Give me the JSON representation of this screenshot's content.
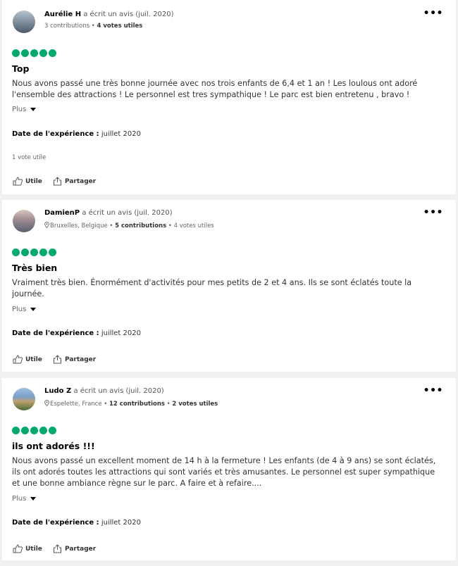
{
  "reviews": [
    {
      "author": "Aurélie H",
      "wrote": "a écrit un avis (juil. 2020)",
      "location": "",
      "contributions": "3 contributions",
      "useful_votes": "4 votes utiles",
      "rating": 5,
      "title": "Top",
      "text": "Nous avons passé une très bonne journée avec nos trois enfants de 6,4 et 1 an ! Les loulous ont adoré l'ensemble des attractions ! Le personnel est tres sympathique ! Le parc est bien entretenu , bravo !",
      "more": "Plus",
      "date_label": "Date de l'expérience :",
      "date_value": "juillet 2020",
      "review_votes": "1 vote utile",
      "useful_label": "Utile",
      "share_label": "Partager",
      "avatar_colors": [
        "#8a9bb0",
        "#3a4a5a"
      ]
    },
    {
      "author": "DamienP",
      "wrote": "a écrit un avis (juil. 2020)",
      "location": "Bruxelles, Belgique",
      "contributions": "5 contributions",
      "useful_votes": "4 votes utiles",
      "rating": 5,
      "title": "Très bien",
      "text": "Vraiment très bien. Énormément d'activités pour mes petits de 2 et 4 ans. Ils se sont éclatés toute la journée.",
      "more": "Plus",
      "date_label": "Date de l'expérience :",
      "date_value": "juillet 2020",
      "review_votes": "",
      "useful_label": "Utile",
      "share_label": "Partager",
      "avatar_colors": [
        "#c9b8a8",
        "#6d6f80"
      ]
    },
    {
      "author": "Ludo Z",
      "wrote": "a écrit un avis (juil. 2020)",
      "location": "Espelette, France",
      "contributions": "12 contributions",
      "useful_votes": "2 votes utiles",
      "rating": 5,
      "title": "ils ont adorés !!!",
      "text": "Nous avons passé un excellent moment de 14 h à la fermeture ! Les enfants (de 4 à 9 ans) se sont éclatés, ils ont adorés toutes les attractions qui sont variés et très amusantes. Le personnel est super sympathique et une bonne ambiance règne sur le parc. A faire et à refaire....",
      "more": "Plus",
      "date_label": "Date de l'expérience :",
      "date_value": "juillet 2020",
      "review_votes": "",
      "useful_label": "Utile",
      "share_label": "Partager",
      "avatar_colors": [
        "#7aa0c8",
        "#4a6a3a"
      ]
    }
  ],
  "colors": {
    "bubble": "#00aa6c",
    "background": "#f0f0f0"
  }
}
